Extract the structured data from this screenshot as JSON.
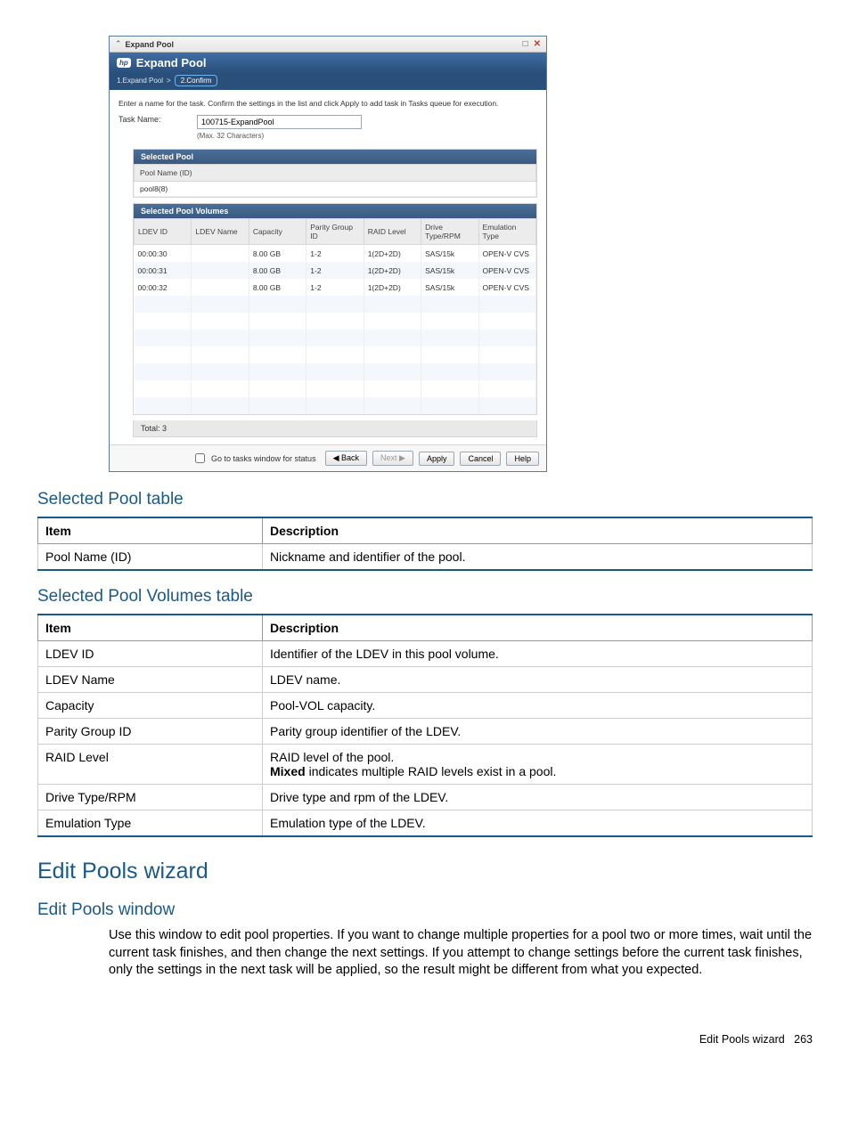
{
  "dialog": {
    "titlebar": {
      "title": "Expand Pool"
    },
    "header": {
      "logo": "hp",
      "title": "Expand Pool"
    },
    "steps": {
      "step1": "1.Expand Pool",
      "sep": ">",
      "step2": "2.Confirm"
    },
    "instruction": "Enter a name for the task. Confirm the settings in the list and click Apply to add task in Tasks queue for execution.",
    "taskname": {
      "label": "Task Name:",
      "value": "100715-ExpandPool",
      "hint": "(Max. 32 Characters)"
    },
    "selected_pool": {
      "title": "Selected Pool",
      "header": "Pool Name (ID)",
      "value": "pool8(8)"
    },
    "selected_pool_volumes": {
      "title": "Selected Pool Volumes",
      "columns": [
        "LDEV ID",
        "LDEV Name",
        "Capacity",
        "Parity Group ID",
        "RAID Level",
        "Drive Type/RPM",
        "Emulation Type"
      ],
      "rows": [
        [
          "00:00:30",
          "",
          "8.00 GB",
          "1-2",
          "1(2D+2D)",
          "SAS/15k",
          "OPEN-V CVS"
        ],
        [
          "00:00:31",
          "",
          "8.00 GB",
          "1-2",
          "1(2D+2D)",
          "SAS/15k",
          "OPEN-V CVS"
        ],
        [
          "00:00:32",
          "",
          "8.00 GB",
          "1-2",
          "1(2D+2D)",
          "SAS/15k",
          "OPEN-V CVS"
        ]
      ],
      "total": "Total:  3"
    },
    "footer": {
      "checkbox": "Go to tasks window for status",
      "back": "◀ Back",
      "next": "Next ▶",
      "apply": "Apply",
      "cancel": "Cancel",
      "help": "Help"
    }
  },
  "doc": {
    "selected_pool_table": {
      "heading": "Selected Pool table",
      "cols": [
        "Item",
        "Description"
      ],
      "rows": [
        [
          "Pool Name (ID)",
          "Nickname and identifier of the pool."
        ]
      ]
    },
    "selected_pool_volumes_table": {
      "heading": "Selected Pool Volumes table",
      "cols": [
        "Item",
        "Description"
      ],
      "rows": [
        [
          "LDEV ID",
          "Identifier of the LDEV in this pool volume."
        ],
        [
          "LDEV Name",
          "LDEV name."
        ],
        [
          "Capacity",
          "Pool-VOL capacity."
        ],
        [
          "Parity Group ID",
          "Parity group identifier of the LDEV."
        ],
        [
          "RAID Level",
          "RAID level of the pool.\n<strong>Mixed</strong> indicates multiple RAID levels exist in a pool."
        ],
        [
          "Drive Type/RPM",
          "Drive type and rpm of the LDEV."
        ],
        [
          "Emulation Type",
          "Emulation type of the LDEV."
        ]
      ]
    },
    "edit_pools_wizard": {
      "heading": "Edit Pools wizard",
      "subheading": "Edit Pools window",
      "paragraph": "Use this window to edit pool properties. If you want to change multiple properties for a pool two or more times, wait until the current task finishes, and then change the next settings. If you attempt to change settings before the current task finishes, only the settings in the next task will be applied, so the result might be different from what you expected."
    },
    "footer": {
      "label": "Edit Pools wizard",
      "page": "263"
    }
  }
}
